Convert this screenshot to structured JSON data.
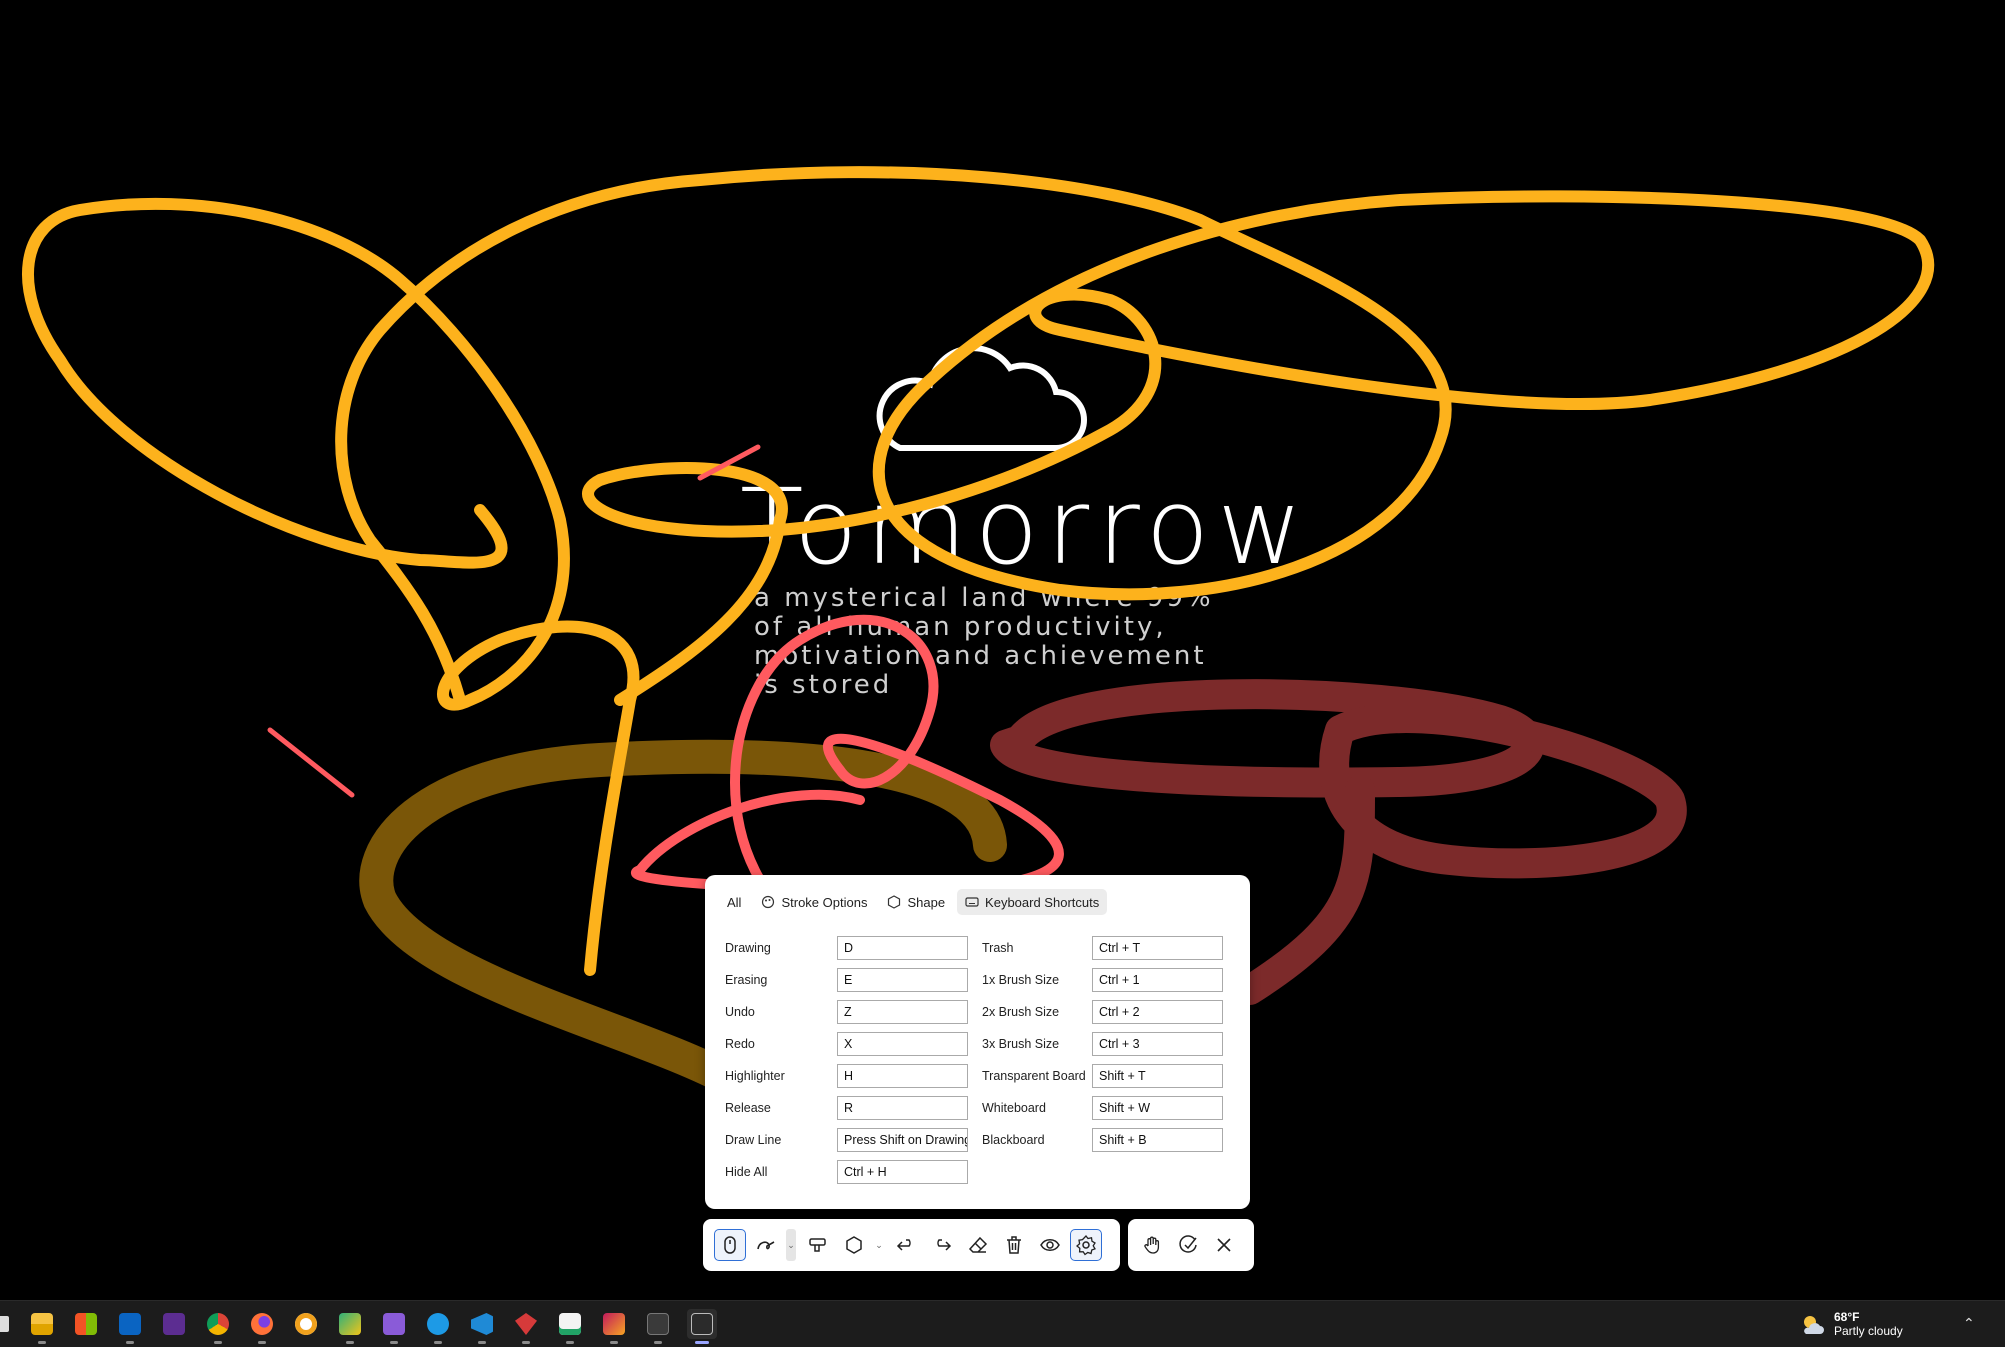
{
  "wallpaper": {
    "title": "Tomorrow",
    "subtitle": "a mysterical land where 99% of all human productivity, motivation and achievement is stored",
    "logo": "cloud-outline-icon"
  },
  "ink_colors": {
    "orange": "#FDB21C",
    "brown": "#7A5608",
    "coral": "#FF5A5F",
    "maroon": "#7C2A2A"
  },
  "panel": {
    "tabs": [
      {
        "label": "All",
        "icon": ""
      },
      {
        "label": "Stroke Options",
        "icon": "palette-icon"
      },
      {
        "label": "Shape",
        "icon": "hexagon-icon"
      },
      {
        "label": "Keyboard Shortcuts",
        "icon": "keyboard-icon"
      }
    ],
    "active_tab": "Keyboard Shortcuts",
    "shortcuts_left": [
      {
        "label": "Drawing",
        "value": "D"
      },
      {
        "label": "Erasing",
        "value": "E"
      },
      {
        "label": "Undo",
        "value": "Z"
      },
      {
        "label": "Redo",
        "value": "X"
      },
      {
        "label": "Highlighter",
        "value": "H"
      },
      {
        "label": "Release",
        "value": "R"
      },
      {
        "label": "Draw Line",
        "value": "Press Shift on Drawing"
      },
      {
        "label": "Hide All",
        "value": "Ctrl + H"
      }
    ],
    "shortcuts_right": [
      {
        "label": "Trash",
        "value": "Ctrl + T"
      },
      {
        "label": "1x Brush Size",
        "value": "Ctrl + 1"
      },
      {
        "label": "2x Brush Size",
        "value": "Ctrl + 2"
      },
      {
        "label": "3x Brush Size",
        "value": "Ctrl + 3"
      },
      {
        "label": "Transparent Board",
        "value": "Shift + T"
      },
      {
        "label": "Whiteboard",
        "value": "Shift + W"
      },
      {
        "label": "Blackboard",
        "value": "Shift + B"
      }
    ]
  },
  "toolbar": {
    "tools": [
      "release-mouse-icon",
      "pen-icon",
      "highlighter-icon",
      "shape-hexagon-icon",
      "undo-icon",
      "redo-icon",
      "eraser-icon",
      "trash-icon",
      "eye-icon",
      "settings-gear-icon"
    ],
    "right_tools": [
      "hand-pan-icon",
      "click-through-icon",
      "close-icon"
    ]
  },
  "taskbar": {
    "apps": [
      "start-icon",
      "file-explorer-icon",
      "microsoft-store-icon",
      "outlook-icon",
      "visual-studio-preview-icon",
      "chrome-icon",
      "firefox-icon",
      "github-icon",
      "paint-icon",
      "visual-studio-icon",
      "docker-icon",
      "vscode-icon",
      "ruby-icon",
      "excel-like-icon",
      "rider-icon",
      "terminal-icon",
      "ink-app-icon"
    ],
    "weather_temp": "68°F",
    "weather_desc": "Partly cloudy",
    "weather_icon": "partly-cloudy-icon"
  }
}
